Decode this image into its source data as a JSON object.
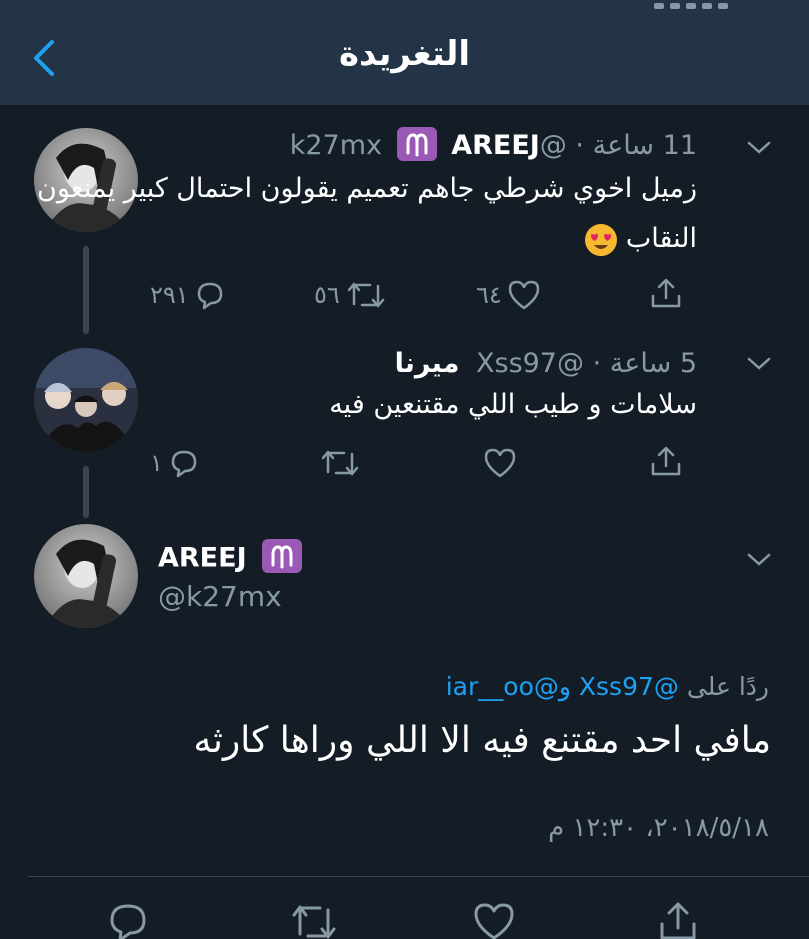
{
  "header": {
    "title": "التغريدة",
    "back_icon": "chevron-left-icon"
  },
  "colors": {
    "background": "#141d26",
    "header": "#243447",
    "accent": "#1da1f2",
    "muted": "#8899a6",
    "badge": "#9b59b6"
  },
  "tweets": [
    {
      "name": "AREEJ",
      "badge": "♈",
      "handle": "@k27mx",
      "time": "11 ساعة",
      "text_line1": "زميل اخوي شرطي جاهم تعميم يقولون احتمال كبير يمنعون",
      "text_line2": "النقاب",
      "emoji": "heart-eyes-emoji",
      "reply_count": "٢٩١",
      "retweet_count": "٥٦",
      "like_count": "٦٤"
    },
    {
      "name": "ميرنا",
      "handle": "@Xss97",
      "time": "5 ساعة",
      "text_line1": "سلامات و طيب اللي مقتنعين فيه",
      "reply_count": "١"
    }
  ],
  "main_tweet": {
    "name": "AREEJ",
    "badge": "♈",
    "handle": "@k27mx",
    "reply_prefix": "ردًا على",
    "mention1": "@Xss97",
    "conj": "و",
    "mention2": "@iar__oo",
    "text": "مافي احد مقتنع فيه الا اللي وراها كارثه",
    "timestamp": "٢٠١٨/٥/١٨، ١٢:٣٠ م"
  }
}
